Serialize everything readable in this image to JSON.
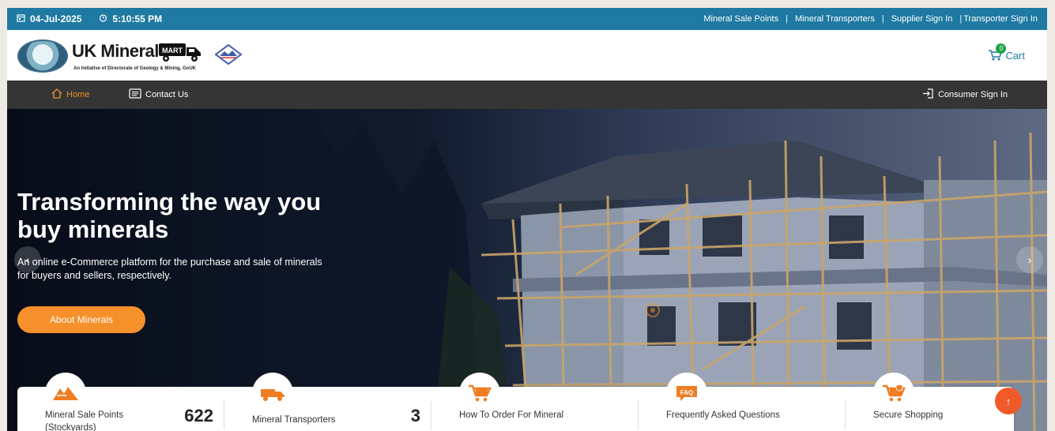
{
  "topbar": {
    "date": "04-Jul-2025",
    "time": "5:10:55 PM",
    "links": [
      "Mineral Sale Points",
      "Mineral Transporters",
      "Supplier Sign In",
      "Transporter Sign In"
    ]
  },
  "header": {
    "brand": "UK Mineral",
    "brand_badge": "MART",
    "tagline": "An Initiative of Directorate of Geology & Mining, GoUK",
    "cart_label": "Cart",
    "cart_count": "0"
  },
  "nav": {
    "home": "Home",
    "contact": "Contact Us",
    "signin": "Consumer Sign In"
  },
  "hero": {
    "title": "Transforming the way you buy minerals",
    "subtitle": "An online e-Commerce platform for the purchase and sale of minerals for buyers and sellers, respectively.",
    "button": "About Minerals"
  },
  "stats": [
    {
      "label": "Mineral Sale Points (Stockyards)",
      "value": "622",
      "icon": "stockpile-icon"
    },
    {
      "label": "Mineral Transporters",
      "value": "3",
      "icon": "truck-icon"
    },
    {
      "label": "How To Order For Mineral",
      "value": "",
      "icon": "cart-icon"
    },
    {
      "label": "Frequently Asked Questions",
      "value": "",
      "icon": "faq-icon"
    },
    {
      "label": "Secure Shopping",
      "value": "",
      "icon": "secure-cart-icon"
    }
  ],
  "colors": {
    "topbar": "#1e7aa2",
    "nav": "#353535",
    "accent": "#f5902a",
    "scroll_top": "#f05a28"
  }
}
